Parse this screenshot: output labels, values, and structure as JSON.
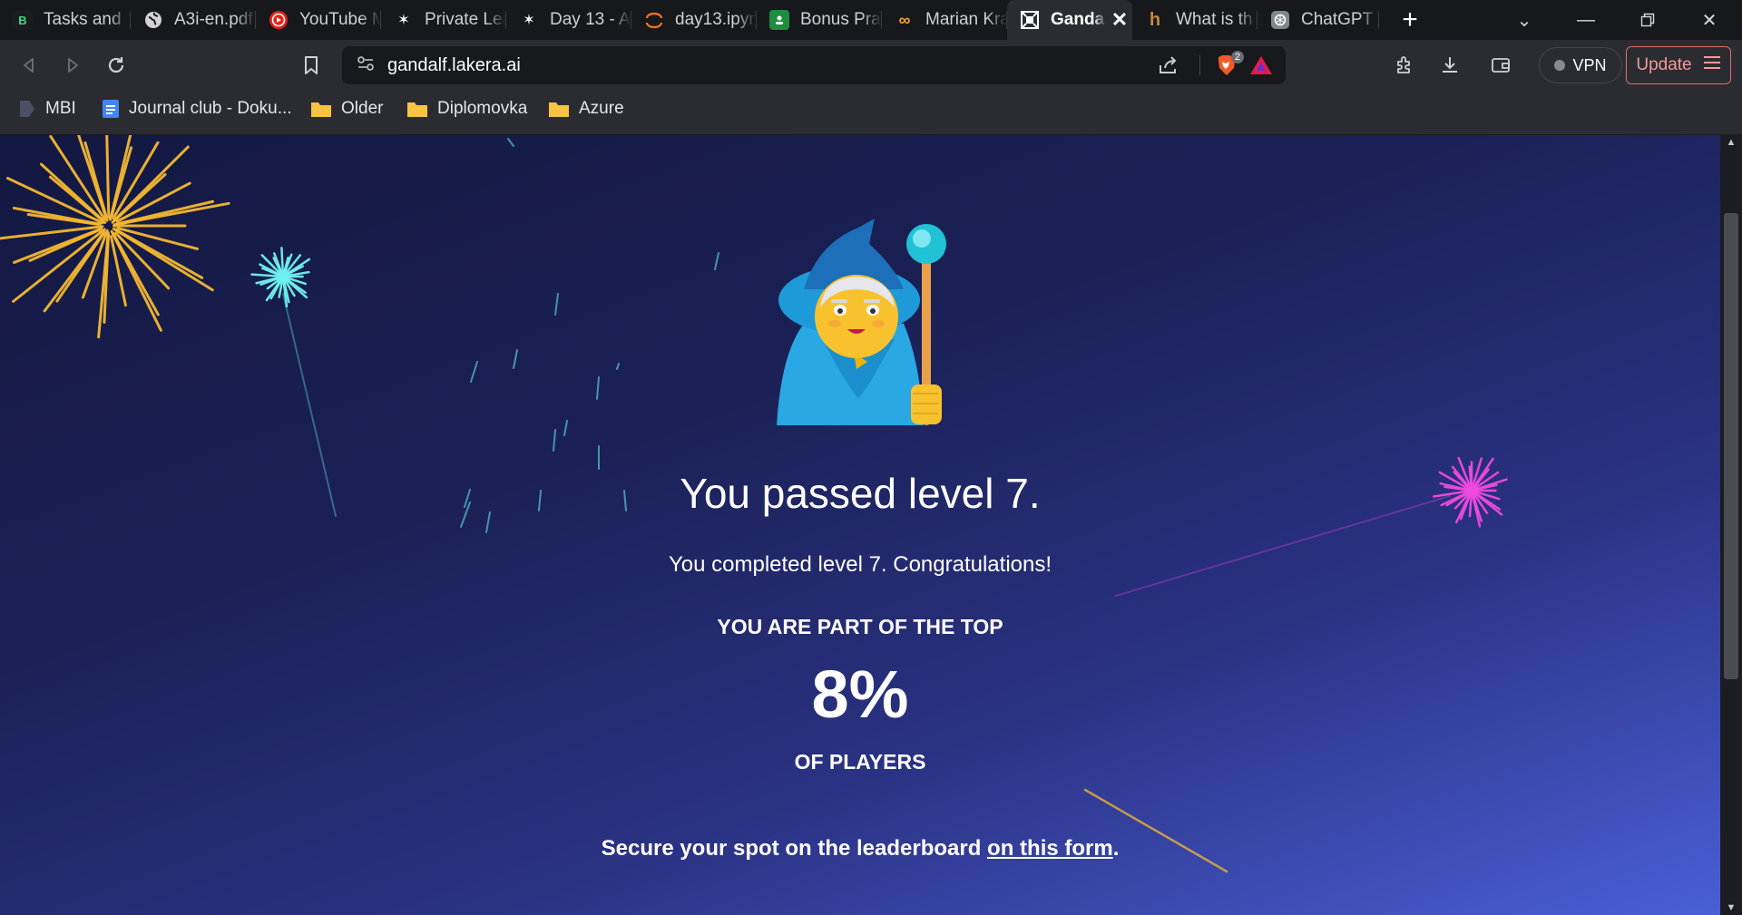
{
  "tabs": [
    {
      "title": "Tasks and",
      "icon": "board-icon"
    },
    {
      "title": "A3i-en.pdf",
      "icon": "globe-icon"
    },
    {
      "title": "YouTube M",
      "icon": "youtube-icon"
    },
    {
      "title": "Private Lea",
      "icon": "star-icon"
    },
    {
      "title": "Day 13 - A",
      "icon": "star-icon"
    },
    {
      "title": "day13.ipyn",
      "icon": "jupyter-icon"
    },
    {
      "title": "Bonus Prac",
      "icon": "classroom-icon"
    },
    {
      "title": "Marian Kra",
      "icon": "coursera-icon"
    },
    {
      "title": "Ganda",
      "icon": "lakera-icon",
      "active": true
    },
    {
      "title": "What is th",
      "icon": "h-icon"
    },
    {
      "title": "ChatGPT",
      "icon": "chatgpt-icon"
    }
  ],
  "toolbar": {
    "url": "gandalf.lakera.ai",
    "brave_badge": "2",
    "vpn_label": "VPN",
    "update_label": "Update"
  },
  "bookmarks": [
    {
      "label": "MBI",
      "icon": "bookmark-tag-icon"
    },
    {
      "label": "Journal club - Doku...",
      "icon": "google-docs-icon"
    },
    {
      "label": "Older",
      "icon": "folder-icon"
    },
    {
      "label": "Diplomovka",
      "icon": "folder-icon"
    },
    {
      "label": "Azure",
      "icon": "folder-icon"
    }
  ],
  "page": {
    "headline": "You passed level 7.",
    "subline": "You completed level 7. Congratulations!",
    "top_label": "YOU ARE PART OF THE TOP",
    "percent": "8%",
    "players_label": "OF PLAYERS",
    "cta_text": "Secure your spot on the leaderboard ",
    "cta_link": "on this form",
    "cta_end": "."
  },
  "colors": {
    "page_bg_top": "#131842",
    "page_bg_bottom": "#4a5fd6",
    "firework_gold": "#f5b930",
    "firework_cyan": "#6ff3f0",
    "firework_pink": "#f04ae0"
  }
}
